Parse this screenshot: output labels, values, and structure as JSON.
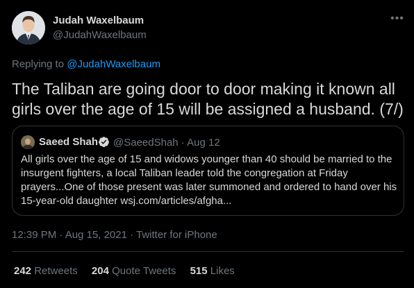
{
  "author": {
    "name": "Judah Waxelbaum",
    "handle": "@JudahWaxelbaum",
    "avatar_icon": "person-avatar"
  },
  "more_icon": "more-options-icon",
  "reply": {
    "prefix": "Replying to",
    "to": "@JudahWaxelbaum"
  },
  "tweet": {
    "text": "The Taliban are going door to door making it known all girls over the age of 15 will be assigned a husband. (7/)"
  },
  "quote": {
    "name": "Saeed Shah",
    "verified_icon": "verified-badge-icon",
    "meta": "@SaeedShah · Aug 12",
    "text": "All girls over the age of 15 and widows younger than 40 should be married to the insurgent fighters, a local Taliban leader told the congregation at Friday prayers...One of those present was later summoned and ordered to hand over his 15-year-old daughter  wsj.com/articles/afgha..."
  },
  "timestamp": "12:39 PM · Aug 15, 2021 · Twitter for iPhone",
  "stats": [
    {
      "count": "242",
      "label": "Retweets"
    },
    {
      "count": "204",
      "label": "Quote Tweets"
    },
    {
      "count": "515",
      "label": "Likes"
    }
  ],
  "colors": {
    "background": "#000000",
    "text": "#d9d9d9",
    "muted": "#6e767d",
    "link": "#1d9bf0",
    "border": "#2f3336"
  }
}
